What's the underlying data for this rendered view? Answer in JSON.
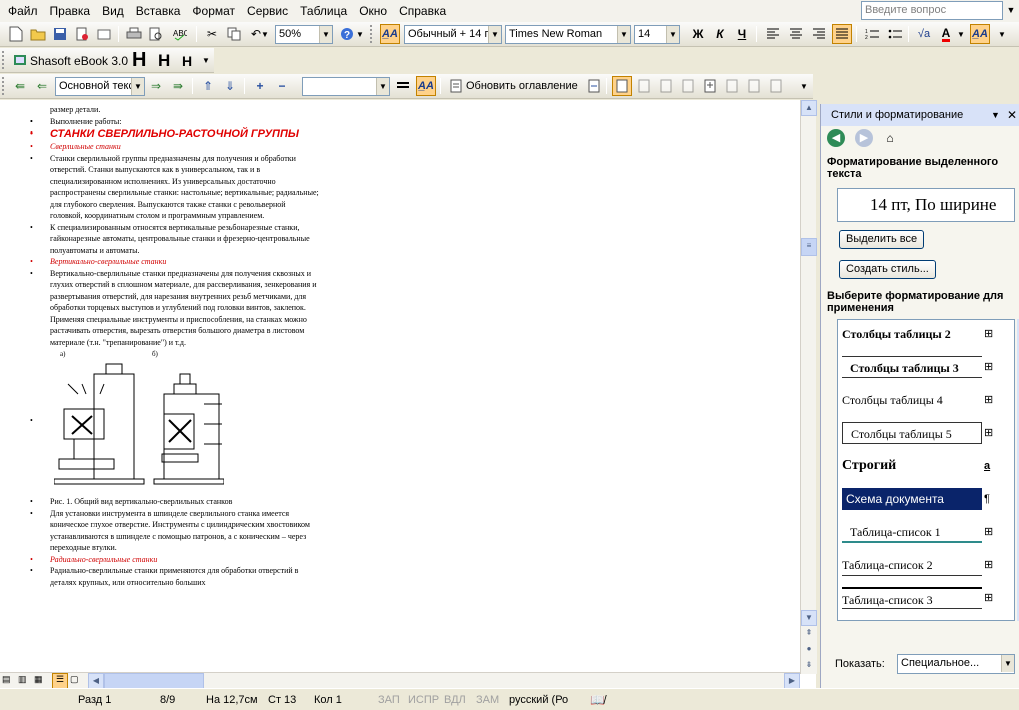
{
  "menu": {
    "items": [
      "Файл",
      "Правка",
      "Вид",
      "Вставка",
      "Формат",
      "Сервис",
      "Таблица",
      "Окно",
      "Справка"
    ],
    "help_placeholder": "Введите вопрос"
  },
  "toolbar1": {
    "zoom": "50%",
    "style": "Обычный + 14 г",
    "font": "Times New Roman",
    "size": "14",
    "bold": "Ж",
    "italic": "К",
    "underline": "Ч"
  },
  "toolbar2": {
    "addin": "Shasoft eBook 3.0",
    "h1": "H",
    "h2": "H",
    "h3": "H"
  },
  "toolbar3": {
    "outline_level": "Основной текс",
    "update_toc": "Обновить оглавление"
  },
  "document": {
    "lines": [
      {
        "text": "размер детали.",
        "bullet": false,
        "style": "normal"
      },
      {
        "text": "",
        "bullet": true,
        "style": "normal"
      },
      {
        "text": "Выполнение работы:",
        "bullet": true,
        "style": "normal"
      },
      {
        "text": "",
        "bullet": true,
        "style": "red"
      },
      {
        "text": "СТАНКИ СВЕРЛИЛЬНО-РАСТОЧНОЙ ГРУППЫ",
        "bullet": true,
        "style": "heading"
      },
      {
        "text": "Сверлильные станки",
        "bullet": true,
        "style": "red"
      },
      {
        "text": "Станки сверлильной группы предназначены для получения и обработки отверстий. Станки выпускаются как в универсальном, так и в специализированном исполнениях. Из универсальных достаточно распространены сверлильные станки: настольные; вертикальные; радиальные; для глубокого сверления. Выпускаются также станки с револьверной головкой, координатным столом и программным управлением.",
        "bullet": true,
        "style": "normal"
      },
      {
        "text": "К специализированным относятся вертикальные резьбонарезные станки, гайконарезные автоматы, центровальные станки и фрезерно-центровальные полуавтоматы и автоматы.",
        "bullet": true,
        "style": "normal"
      },
      {
        "text": "Вертикально-сверлильные станки",
        "bullet": true,
        "style": "red"
      },
      {
        "text": "Вертикально-сверлильные станки предназначены для получения сквозных и глухих отверстий в сплошном материале, для рассверливания, зенкерования и развертывания отверстий, для нарезания внутренних резьб метчиками, для обработки торцевых выступов и углублений под головки винтов, заклепок. Применяя специальные инструменты и приспособления, на станках можно растачивать отверстия, вырезать отверстия большого диаметра в листовом материале (т.н. \"трепанирование\") и т.д.",
        "bullet": true,
        "style": "normal"
      }
    ],
    "figure_labels": {
      "a": "а)",
      "b": "б)"
    },
    "lines_after": [
      {
        "text": "Рис. 1. Общий вид вертикально-сверлильных станков",
        "bullet": true,
        "style": "normal"
      },
      {
        "text": "Для установки инструмента в шпинделе сверлильного станка имеется коническое глухое отверстие. Инструменты с цилиндрическим хвостовиком устанавливаются в шпинделе с помощью патронов, а с коническим – через переходные втулки.",
        "bullet": true,
        "style": "normal"
      },
      {
        "text": "Радиально-сверлильные станки",
        "bullet": true,
        "style": "red"
      },
      {
        "text": "Радиально-сверлильные станки применяются для обработки отверстий в деталях крупных, или относительно больших",
        "bullet": true,
        "style": "normal"
      }
    ]
  },
  "status": {
    "section": "Разд  1",
    "pages": "8/9",
    "at": "На 12,7см",
    "line": "Ст  13",
    "col": "Кол  1",
    "rec": "ЗАП",
    "trk": "ИСПР",
    "ext": "ВДЛ",
    "ovr": "ЗАМ",
    "lang": "русский (Ро"
  },
  "panel": {
    "title": "Стили и форматирование",
    "selected_label": "Форматирование выделенного текста",
    "selected_value": "14 пт, По ширине",
    "select_all": "Выделить все",
    "new_style": "Создать стиль...",
    "apply_label": "Выберите форматирование для применения",
    "styles": [
      {
        "name": "Столбцы таблицы 2",
        "mark": "⊞",
        "bold": true
      },
      {
        "name": "Столбцы таблицы 3",
        "mark": "⊞",
        "bold": true
      },
      {
        "name": "Столбцы таблицы 4",
        "mark": "⊞",
        "bold": false
      },
      {
        "name": "Столбцы таблицы 5",
        "mark": "⊞",
        "bold": false
      },
      {
        "name": "Строгий",
        "mark": "a",
        "bold": true
      },
      {
        "name": "Схема документа",
        "mark": "¶",
        "bold": false
      },
      {
        "name": "Таблица-список 1",
        "mark": "⊞",
        "bold": false
      },
      {
        "name": "Таблица-список 2",
        "mark": "⊞",
        "bold": false
      },
      {
        "name": "Таблица-список 3",
        "mark": "⊞",
        "bold": false
      }
    ],
    "show_label": "Показать:",
    "show_value": "Специальное..."
  },
  "colors": {
    "accent": "#0A246A",
    "red_text": "#D00000",
    "panel_header": "#D8E2F8"
  }
}
